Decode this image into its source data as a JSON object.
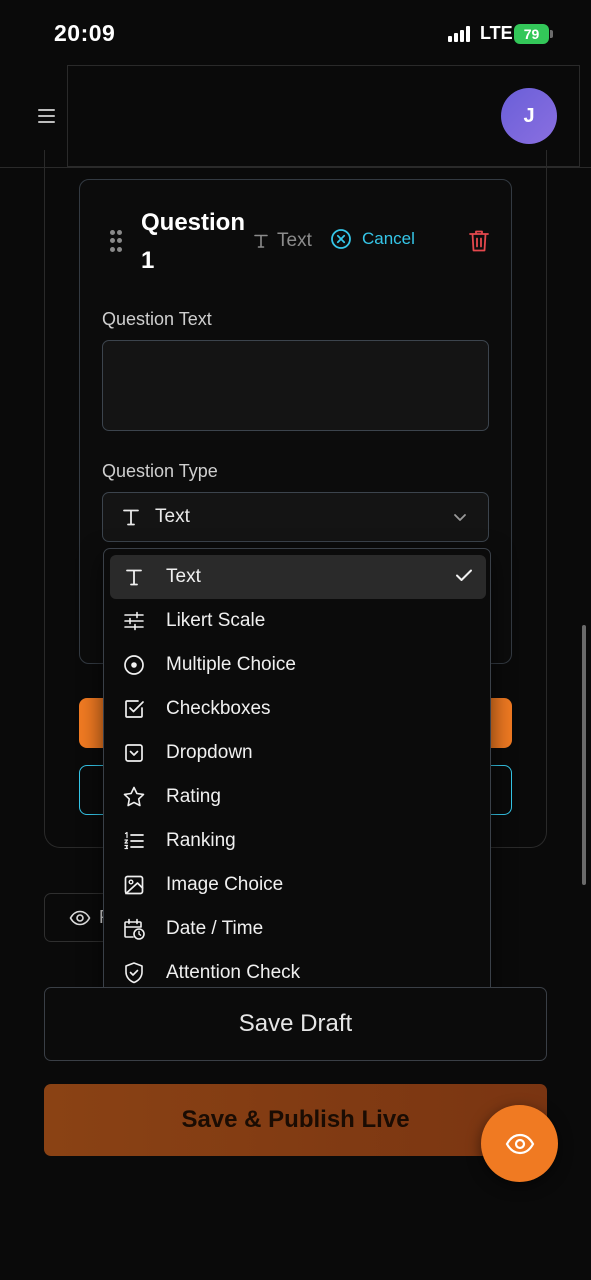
{
  "status_bar": {
    "time": "20:09",
    "network": "LTE",
    "battery": "79"
  },
  "header": {
    "avatar_initial": "J"
  },
  "question": {
    "title": "Question 1",
    "type_badge": "Text",
    "cancel_label": "Cancel",
    "text_label": "Question Text",
    "text_value": "",
    "type_label": "Question Type",
    "type_selected": "Text"
  },
  "dropdown": {
    "options": [
      {
        "label": "Text",
        "icon": "text-icon",
        "selected": true
      },
      {
        "label": "Likert Scale",
        "icon": "sliders-icon"
      },
      {
        "label": "Multiple Choice",
        "icon": "radio-icon"
      },
      {
        "label": "Checkboxes",
        "icon": "checkbox-icon"
      },
      {
        "label": "Dropdown",
        "icon": "dropdown-icon"
      },
      {
        "label": "Rating",
        "icon": "star-icon"
      },
      {
        "label": "Ranking",
        "icon": "ranked-list-icon"
      },
      {
        "label": "Image Choice",
        "icon": "image-icon"
      },
      {
        "label": "Date / Time",
        "icon": "calendar-clock-icon"
      },
      {
        "label": "Attention Check",
        "icon": "shield-check-icon"
      }
    ]
  },
  "preview": {
    "label_fragment": "P"
  },
  "actions": {
    "save_draft": "Save Draft",
    "publish": "Save & Publish Live"
  },
  "colors": {
    "accent_orange": "#f07a22",
    "accent_cyan": "#35c6e8",
    "danger": "#e5484d",
    "battery_green": "#33c759"
  }
}
